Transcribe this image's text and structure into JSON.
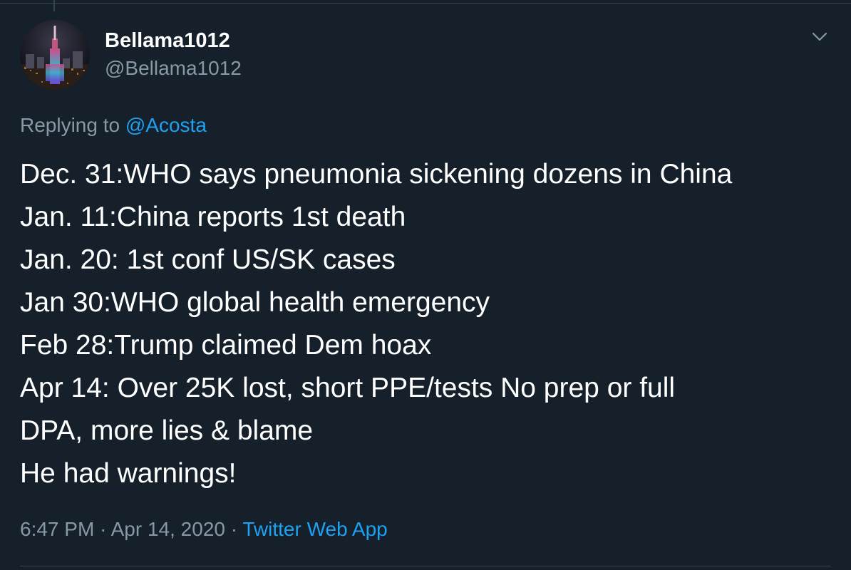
{
  "tweet": {
    "author": {
      "display_name": "Bellama1012",
      "handle": "@Bellama1012",
      "avatar": "avatar-night-city-skyline"
    },
    "menu_icon": "chevron-down-icon",
    "replying_to": {
      "prefix": "Replying to",
      "mention": "@Acosta"
    },
    "text_lines": [
      "Dec. 31:WHO says pneumonia sickening dozens in China",
      "Jan. 11:China reports 1st death",
      "Jan. 20: 1st conf US/SK cases",
      "Jan 30:WHO global health emergency",
      "Feb 28:Trump claimed Dem hoax",
      "Apr 14: Over 25K lost, short PPE/tests No prep or full",
      "DPA, more lies & blame",
      "He had warnings!"
    ],
    "time": "6:47 PM",
    "separator": "·",
    "date": "Apr 14, 2020",
    "source": "Twitter Web App"
  },
  "colors": {
    "background": "#15202b",
    "text_primary": "#ffffff",
    "text_secondary": "#8899a6",
    "accent": "#1da1f2",
    "border": "#38444d"
  }
}
